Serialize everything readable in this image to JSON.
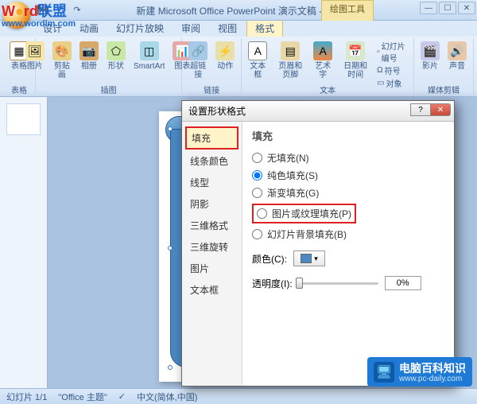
{
  "title": "新建 Microsoft Office PowerPoint 演示文稿 - M...",
  "contextual_tab": "绘图工具",
  "menu": [
    "设计",
    "动画",
    "幻灯片放映",
    "审阅",
    "视图",
    "格式"
  ],
  "ribbon": {
    "groups": [
      {
        "label": "表格",
        "items": [
          {
            "label": "表格"
          }
        ]
      },
      {
        "label": "插图",
        "items": [
          {
            "label": "图片"
          },
          {
            "label": "剪贴画"
          },
          {
            "label": "相册"
          },
          {
            "label": "形状"
          },
          {
            "label": "SmartArt"
          },
          {
            "label": "图表"
          }
        ]
      },
      {
        "label": "链接",
        "items": [
          {
            "label": "超链接"
          },
          {
            "label": "动作"
          }
        ]
      },
      {
        "label": "文本",
        "items": [
          {
            "label": "文本框"
          },
          {
            "label": "页眉和\n页脚"
          },
          {
            "label": "艺术字"
          },
          {
            "label": "日期和\n时间"
          }
        ],
        "extras": [
          "幻灯片编号",
          "符号",
          "对象"
        ]
      },
      {
        "label": "媒体剪辑",
        "items": [
          {
            "label": "影片"
          },
          {
            "label": "声音"
          }
        ]
      }
    ]
  },
  "dialog": {
    "title": "设置形状格式",
    "sidebar": [
      "填充",
      "线条颜色",
      "线型",
      "阴影",
      "三维格式",
      "三维旋转",
      "图片",
      "文本框"
    ],
    "heading": "填充",
    "options": {
      "none": "无填充(N)",
      "solid": "纯色填充(S)",
      "gradient": "渐变填充(G)",
      "picture": "图片或纹理填充(P)",
      "slidebg": "幻灯片背景填充(B)"
    },
    "color_label": "颜色(C):",
    "trans_label": "透明度(I):",
    "trans_value": "0%",
    "close_btn": "关闭"
  },
  "status": {
    "slide": "幻灯片 1/1",
    "theme": "\"Office 主题\"",
    "lang": "中文(简体,中国)"
  },
  "wm1": {
    "brand_a": "W",
    "brand_b": "rd",
    "brand_c": "联盟",
    "url": "www.wordlm.com"
  },
  "wm2": {
    "title": "电脑百科知识",
    "url": "www.pc-daily.com"
  }
}
